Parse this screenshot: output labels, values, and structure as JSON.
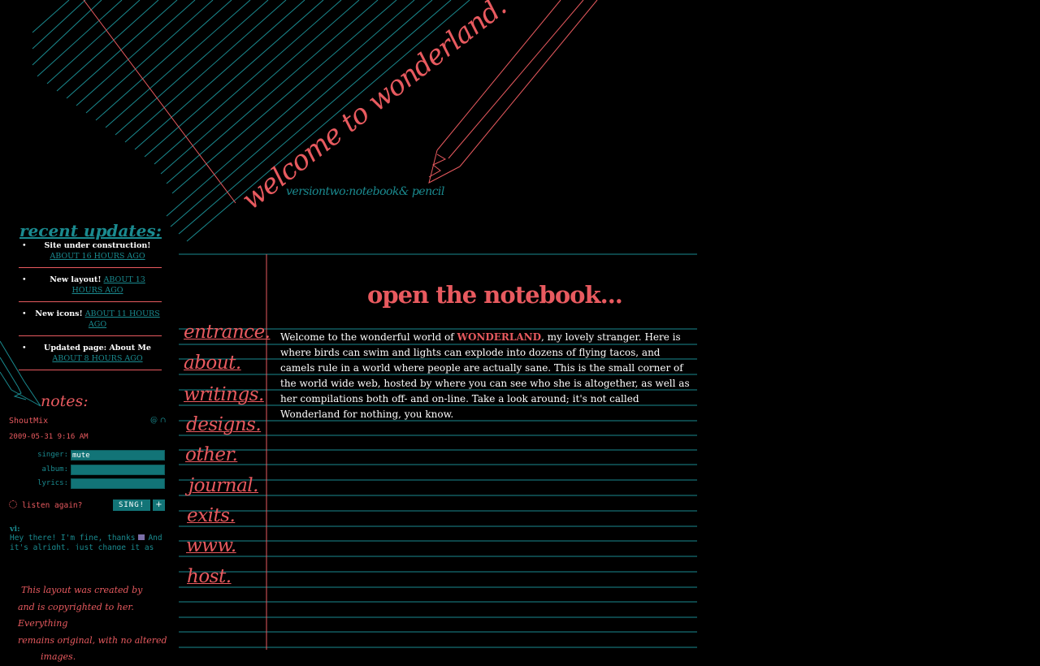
{
  "header": {
    "title": "welcome to wonderland.",
    "subtitle": "versiontwo:notebook& pencil"
  },
  "recent_updates": {
    "title": "recent updates:",
    "items": [
      {
        "text": "Site under construction!",
        "time": "ABOUT 16 HOURS AGO"
      },
      {
        "text": "New layout!",
        "time": "ABOUT 13 HOURS AGO"
      },
      {
        "text": "New icons!",
        "time": "ABOUT 11 HOURS AGO"
      },
      {
        "text": "Updated page: About Me",
        "time": "ABOUT 8 HOURS AGO"
      }
    ]
  },
  "notes": {
    "title": "notes:",
    "brand": "ShoutMix",
    "icons": "@ ∩",
    "date": "2009-05-31 9:16 AM",
    "fields": [
      {
        "label": "singer:",
        "value": "mute"
      },
      {
        "label": "album:",
        "value": ""
      },
      {
        "label": "lyrics:",
        "value": ""
      }
    ],
    "listen_again": "listen again?",
    "sing_label": "SING!",
    "plus_label": "+",
    "shout_name": "vi:",
    "shout_message": "Hey there! I'm fine, thanks",
    "shout_message_tail": "And it's alright, just change it as you see more"
  },
  "copyright": [
    "This layout was created by",
    "and is copyrighted to her. Everything",
    "remains original, with no altered",
    "images."
  ],
  "main": {
    "title": "open the notebook...",
    "intro_before": "Welcome to the wonderful world of ",
    "intro_brand": "WONDERLAND",
    "intro_after": ", my lovely stranger. Here is where birds can swim and lights can explode into dozens of flying tacos, and camels rule in a world where people are actually sane. This is the small corner of the world wide web, hosted by where you can see who she is altogether, as well as her compilations both off- and on-line. Take a look around; it's not called Wonderland for nothing, you know."
  },
  "nav": [
    "entrance.",
    "about.",
    "writings.",
    "designs.",
    "other.",
    "journal.",
    "exits.",
    "www.",
    "host."
  ],
  "colors": {
    "background": "#000000",
    "accent_red": "#e85a5f",
    "teal": "#1a8a8f",
    "field_teal": "#127477"
  }
}
